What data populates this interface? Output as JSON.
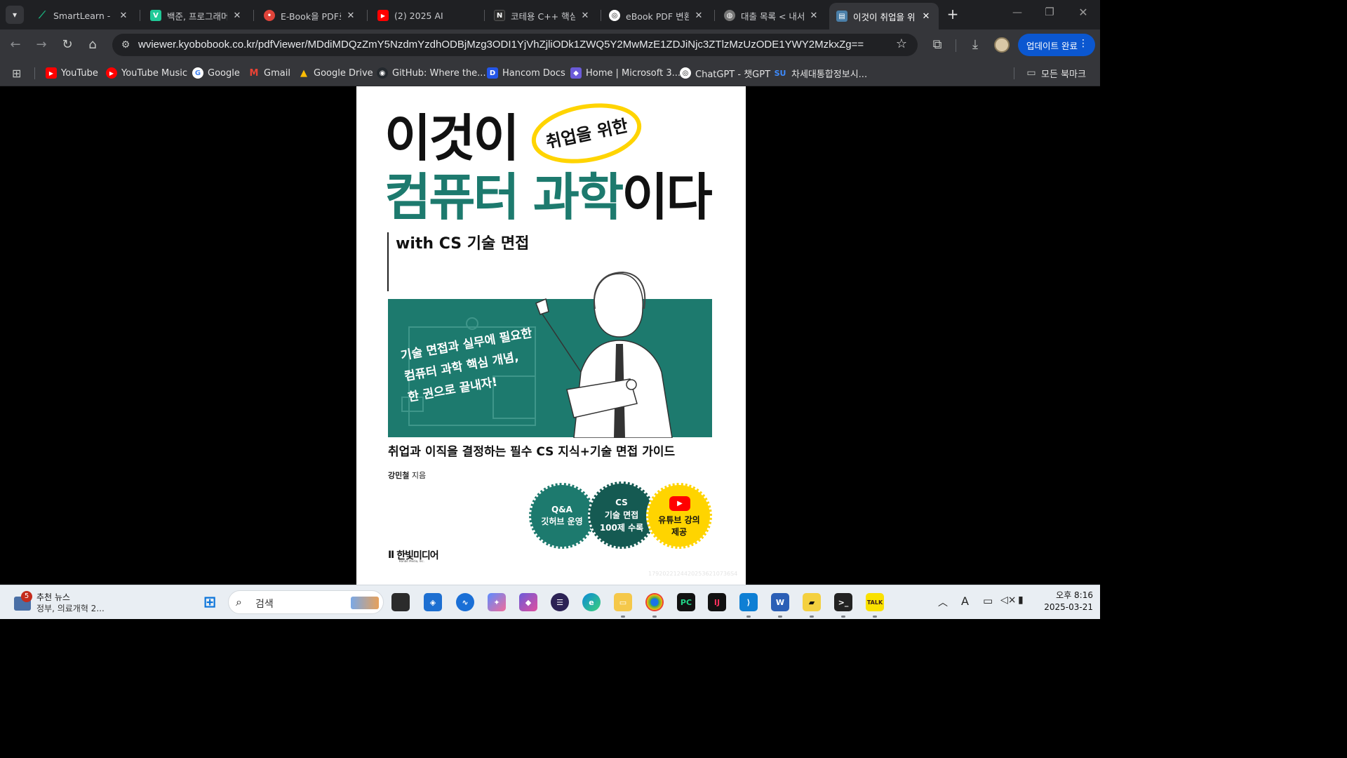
{
  "tabs": [
    {
      "title": "SmartLearn - PA",
      "icon": "smartlearn-icon",
      "color": "#1bb27e"
    },
    {
      "title": "백준, 프로그래머",
      "icon": "v-icon",
      "color": "#20c997"
    },
    {
      "title": "E-Book을 PDF로",
      "icon": "red-circle-icon",
      "color": "#e0443a"
    },
    {
      "title": "(2) 2025 AI",
      "icon": "youtube-icon",
      "color": "#ff0000"
    },
    {
      "title": "코테용 C++ 핵심",
      "icon": "notion-icon",
      "color": "#2b2b2b"
    },
    {
      "title": "eBook PDF 변환",
      "icon": "chatgpt-icon",
      "color": "#555555"
    },
    {
      "title": "대출 목록 < 내서",
      "icon": "globe-icon",
      "color": "#777777"
    },
    {
      "title": "이것이 취업을 위",
      "icon": "document-icon",
      "color": "#4a7fa8"
    }
  ],
  "address_bar": {
    "url": "wviewer.kyobobook.co.kr/pdfViewer/MDdiMDQzZmY5NzdmYzdhODBjMzg3ODI1YjVhZjliODk1ZWQ5Y2MwMzE1ZDJiNjc3ZTlzMzUzODE1YWY2MzkxZg=="
  },
  "update_button": {
    "label": "업데이트 완료"
  },
  "bookmarks": [
    {
      "label": "YouTube",
      "icon": "youtube-icon",
      "color": "#ff0000"
    },
    {
      "label": "YouTube Music",
      "icon": "youtube-music-icon",
      "color": "#ff0000"
    },
    {
      "label": "Google",
      "icon": "google-icon",
      "color": "#ffffff"
    },
    {
      "label": "Gmail",
      "icon": "gmail-icon",
      "color": "#ea4335"
    },
    {
      "label": "Google Drive",
      "icon": "drive-icon",
      "color": "#1fa463"
    },
    {
      "label": "GitHub: Where the...",
      "icon": "github-icon",
      "color": "#24292e"
    },
    {
      "label": "Hancom Docs",
      "icon": "hancom-icon",
      "color": "#2456e8"
    },
    {
      "label": "Home | Microsoft 3...",
      "icon": "microsoft365-icon",
      "color": "#6b5bd9"
    },
    {
      "label": "ChatGPT - 챗GPT",
      "icon": "chatgpt-icon",
      "color": "#444444"
    },
    {
      "label": "차세대통합정보시...",
      "icon": "su-icon",
      "color": "#1f6fd8"
    }
  ],
  "all_bookmarks": {
    "label": "모든 북마크"
  },
  "book": {
    "title_line1": "이것이",
    "title_badge": "취업을 위한",
    "title_green": "컴퓨터 과학",
    "title_suffix": "이다",
    "subtitle": "with CS 기술 면접",
    "board_text": [
      "기술 면접과 실무에 필요한",
      "컴퓨터 과학 핵심 개념,",
      "한 권으로 끝내자!"
    ],
    "tagline": "취업과 이직을 결정하는 필수 CS 지식+기술 면접 가이드",
    "author_name": "강민철",
    "author_suffix": "지음",
    "badges": [
      {
        "text": "Q&A\n깃허브 운영",
        "color": "#1d7a6e"
      },
      {
        "text": "CS\n기술 면접\n100제 수록",
        "color": "#155a52"
      },
      {
        "text": "유튜브 강의\n제공",
        "color": "#ffd400"
      }
    ],
    "publisher": "한빛미디어",
    "publisher_sub": "Hanbit Media, Inc.",
    "watermark": "17920221244202536210736S4"
  },
  "taskbar": {
    "news_title": "추천 뉴스",
    "news_body": "정부, 의료개혁 2...",
    "news_badge": "5",
    "search_placeholder": "검색",
    "time": "오후 8:16",
    "date": "2025-03-21",
    "ime": "A"
  }
}
